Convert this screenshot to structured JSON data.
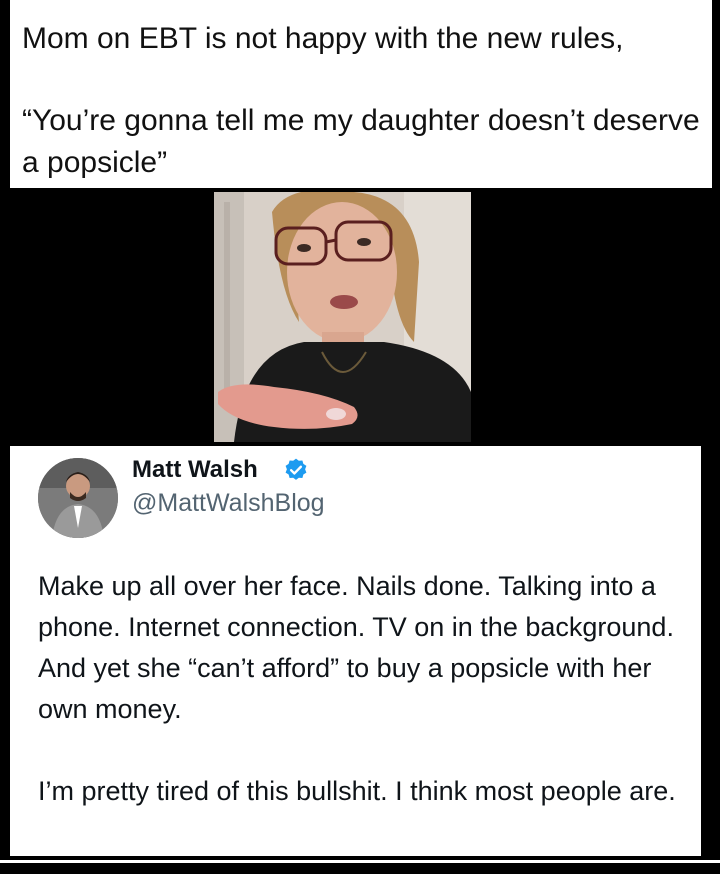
{
  "caption": {
    "line1": "Mom on EBT is not happy with the new rules,",
    "quote": "“You’re gonna tell me my daughter doesn’t deserve a popsicle”"
  },
  "tweet": {
    "author_name": "Matt Walsh",
    "handle": "@MattWalshBlog",
    "paragraph1": "Make up all over her face. Nails done. Talking into a phone. Internet connection. TV on in the background. And yet she “can’t afford” to buy a popsicle with her own money.",
    "paragraph2": "I’m pretty tired of this bullshit. I think most people are.",
    "verified_color": "#1d9bf0"
  },
  "colors": {
    "background": "#000000",
    "panel": "#ffffff",
    "text": "#0f1419",
    "handle": "#536471"
  }
}
